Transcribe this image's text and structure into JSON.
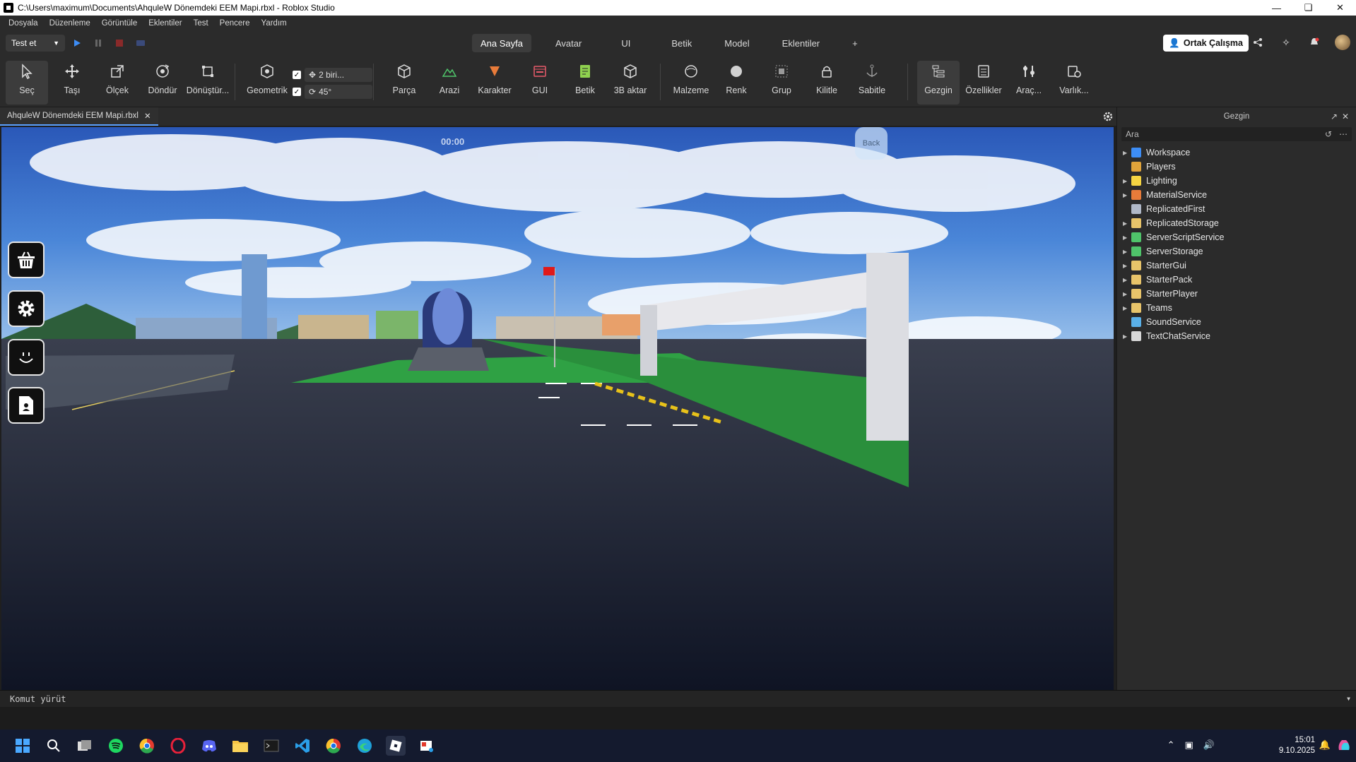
{
  "window": {
    "title": "C:\\Users\\maximum\\Documents\\AhquleW Dönemdeki EEM Mapi.rbxl - Roblox Studio"
  },
  "menu": [
    "Dosyala",
    "Düzenleme",
    "Görüntüle",
    "Eklentiler",
    "Test",
    "Pencere",
    "Yardım"
  ],
  "topbar": {
    "test_label": "Test et",
    "tabs": [
      "Ana Sayfa",
      "Avatar",
      "UI",
      "Betik",
      "Model",
      "Eklentiler",
      "+"
    ],
    "active_tab": "Ana Sayfa",
    "collab_label": "Ortak Çalışma"
  },
  "ribbon": {
    "tools": [
      {
        "label": "Seç",
        "icon": "select-cursor-icon"
      },
      {
        "label": "Taşı",
        "icon": "move-arrows-icon"
      },
      {
        "label": "Ölçek",
        "icon": "scale-icon"
      },
      {
        "label": "Döndür",
        "icon": "rotate-icon"
      },
      {
        "label": "Dönüştür...",
        "icon": "transform-icon"
      },
      {
        "label": "Geometrik",
        "icon": "geometric-icon"
      },
      {
        "label": "Parça",
        "icon": "part-cube-icon"
      },
      {
        "label": "Arazi",
        "icon": "terrain-icon"
      },
      {
        "label": "Karakter",
        "icon": "character-icon"
      },
      {
        "label": "GUI",
        "icon": "gui-icon"
      },
      {
        "label": "Betik",
        "icon": "script-icon"
      },
      {
        "label": "3B aktar",
        "icon": "import-3d-icon"
      },
      {
        "label": "Malzeme",
        "icon": "material-icon"
      },
      {
        "label": "Renk",
        "icon": "color-icon"
      },
      {
        "label": "Grup",
        "icon": "group-icon"
      },
      {
        "label": "Kilitle",
        "icon": "lock-icon"
      },
      {
        "label": "Sabitle",
        "icon": "anchor-icon"
      },
      {
        "label": "Gezgin",
        "icon": "explorer-icon"
      },
      {
        "label": "Özellikler",
        "icon": "properties-icon"
      },
      {
        "label": "Araç...",
        "icon": "toolbox-icon"
      },
      {
        "label": "Varlık...",
        "icon": "asset-manager-icon"
      }
    ],
    "snap_move": "2 biri...",
    "snap_rotate": "45°"
  },
  "document_tab": "AhquleW Dönemdeki EEM Mapi.rbxl",
  "viewport": {
    "timer": "00:00",
    "back_label": "Back"
  },
  "explorer": {
    "title": "Gezgin",
    "search_placeholder": "Ara",
    "items": [
      {
        "name": "Workspace",
        "expandable": true,
        "color": "#3d8df5"
      },
      {
        "name": "Players",
        "expandable": false,
        "color": "#e0a33a"
      },
      {
        "name": "Lighting",
        "expandable": true,
        "color": "#f5d442"
      },
      {
        "name": "MaterialService",
        "expandable": true,
        "color": "#e87b3a"
      },
      {
        "name": "ReplicatedFirst",
        "expandable": false,
        "color": "#b0b8c8"
      },
      {
        "name": "ReplicatedStorage",
        "expandable": true,
        "color": "#e8c46a"
      },
      {
        "name": "ServerScriptService",
        "expandable": true,
        "color": "#4fc46a"
      },
      {
        "name": "ServerStorage",
        "expandable": true,
        "color": "#4fc46a"
      },
      {
        "name": "StarterGui",
        "expandable": true,
        "color": "#e8c46a"
      },
      {
        "name": "StarterPack",
        "expandable": true,
        "color": "#e8c46a"
      },
      {
        "name": "StarterPlayer",
        "expandable": true,
        "color": "#e8c46a"
      },
      {
        "name": "Teams",
        "expandable": true,
        "color": "#e8c46a"
      },
      {
        "name": "SoundService",
        "expandable": false,
        "color": "#5ab0e8"
      },
      {
        "name": "TextChatService",
        "expandable": true,
        "color": "#d8d8d8"
      }
    ]
  },
  "command_bar": {
    "placeholder": "Komut yürüt"
  },
  "taskbar": {
    "time": "15:01",
    "date": "9.10.2025"
  }
}
